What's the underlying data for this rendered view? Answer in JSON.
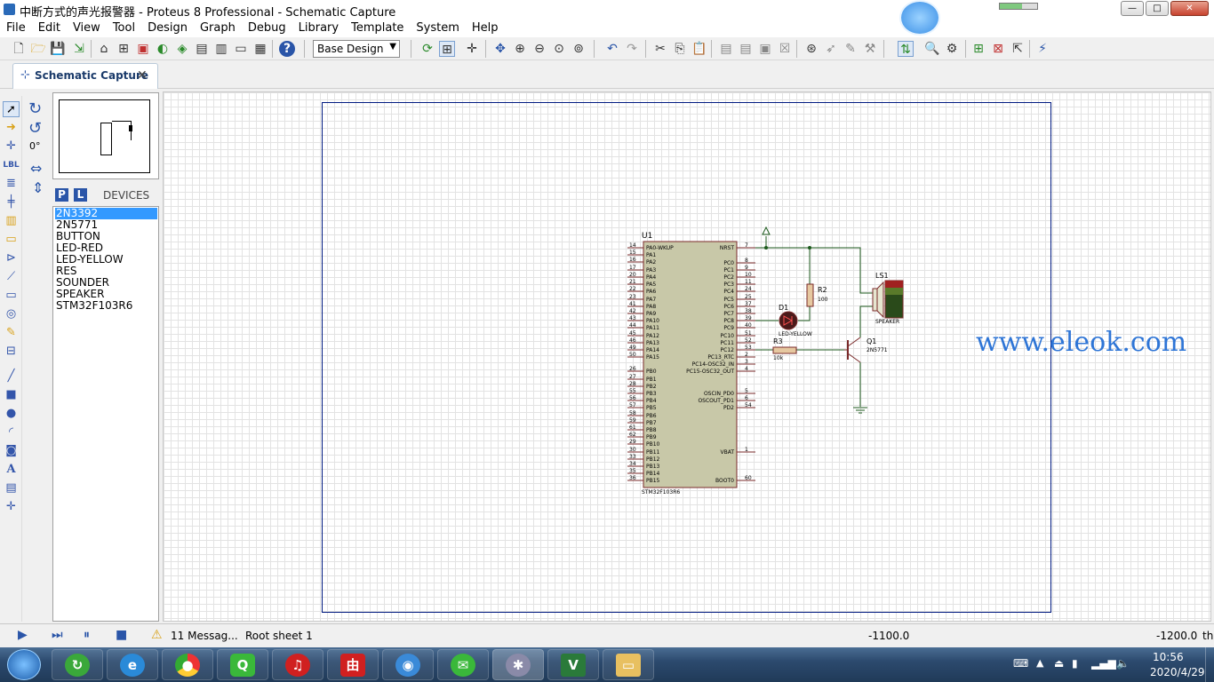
{
  "window": {
    "title": "中断方式的声光报警器 - Proteus 8 Professional - Schematic Capture",
    "controls": {
      "minimize": "—",
      "maximize": "□",
      "close": "✕"
    }
  },
  "menu": [
    "File",
    "Edit",
    "View",
    "Tool",
    "Design",
    "Graph",
    "Debug",
    "Library",
    "Template",
    "System",
    "Help"
  ],
  "toolbar": {
    "design_select": "Base Design",
    "icons": [
      "new",
      "open",
      "save",
      "import",
      "home",
      "schematic",
      "pcb",
      "gerber",
      "3d",
      "bom",
      "notes",
      "help",
      "refresh",
      "grid",
      "origin",
      "pan",
      "zoom-in",
      "zoom-out",
      "zoom-all",
      "zoom-area",
      "undo",
      "redo",
      "cut",
      "copy",
      "paste",
      "block-copy",
      "block-move",
      "block-rotate",
      "block-delete",
      "pick",
      "make-device",
      "packaging",
      "decompose",
      "wire-autoroute",
      "search",
      "property-assign",
      "new-sheet",
      "delete-sheet",
      "exit-to-parent",
      "design-explorer"
    ]
  },
  "tab": {
    "label": "Schematic Capture",
    "close": "✕"
  },
  "left_panel": {
    "rotation": "0°",
    "p_button": "P",
    "l_button": "L",
    "devices_label": "DEVICES",
    "devices": [
      {
        "name": "2N3392",
        "selected": true
      },
      {
        "name": "2N5771",
        "selected": false
      },
      {
        "name": "BUTTON",
        "selected": false
      },
      {
        "name": "LED-RED",
        "selected": false
      },
      {
        "name": "LED-YELLOW",
        "selected": false
      },
      {
        "name": "RES",
        "selected": false
      },
      {
        "name": "SOUNDER",
        "selected": false
      },
      {
        "name": "SPEAKER",
        "selected": false
      },
      {
        "name": "STM32F103R6",
        "selected": false
      }
    ]
  },
  "schematic": {
    "mcu": {
      "ref": "U1",
      "part": "STM32F103R6",
      "left_pins": [
        {
          "num": "14",
          "name": "PA0-WKUP"
        },
        {
          "num": "15",
          "name": "PA1"
        },
        {
          "num": "16",
          "name": "PA2"
        },
        {
          "num": "17",
          "name": "PA3"
        },
        {
          "num": "20",
          "name": "PA4"
        },
        {
          "num": "21",
          "name": "PA5"
        },
        {
          "num": "22",
          "name": "PA6"
        },
        {
          "num": "23",
          "name": "PA7"
        },
        {
          "num": "41",
          "name": "PA8"
        },
        {
          "num": "42",
          "name": "PA9"
        },
        {
          "num": "43",
          "name": "PA10"
        },
        {
          "num": "44",
          "name": "PA11"
        },
        {
          "num": "45",
          "name": "PA12"
        },
        {
          "num": "46",
          "name": "PA13"
        },
        {
          "num": "49",
          "name": "PA14"
        },
        {
          "num": "50",
          "name": "PA15"
        },
        {
          "num": "26",
          "name": "PB0"
        },
        {
          "num": "27",
          "name": "PB1"
        },
        {
          "num": "28",
          "name": "PB2"
        },
        {
          "num": "55",
          "name": "PB3"
        },
        {
          "num": "56",
          "name": "PB4"
        },
        {
          "num": "57",
          "name": "PB5"
        },
        {
          "num": "58",
          "name": "PB6"
        },
        {
          "num": "59",
          "name": "PB7"
        },
        {
          "num": "61",
          "name": "PB8"
        },
        {
          "num": "62",
          "name": "PB9"
        },
        {
          "num": "29",
          "name": "PB10"
        },
        {
          "num": "30",
          "name": "PB11"
        },
        {
          "num": "33",
          "name": "PB12"
        },
        {
          "num": "34",
          "name": "PB13"
        },
        {
          "num": "35",
          "name": "PB14"
        },
        {
          "num": "36",
          "name": "PB15"
        }
      ],
      "right_pins": [
        {
          "num": "7",
          "name": "NRST"
        },
        {
          "num": "8",
          "name": "PC0"
        },
        {
          "num": "9",
          "name": "PC1"
        },
        {
          "num": "10",
          "name": "PC2"
        },
        {
          "num": "11",
          "name": "PC3"
        },
        {
          "num": "24",
          "name": "PC4"
        },
        {
          "num": "25",
          "name": "PC5"
        },
        {
          "num": "37",
          "name": "PC6"
        },
        {
          "num": "38",
          "name": "PC7"
        },
        {
          "num": "39",
          "name": "PC8"
        },
        {
          "num": "40",
          "name": "PC9"
        },
        {
          "num": "51",
          "name": "PC10"
        },
        {
          "num": "52",
          "name": "PC11"
        },
        {
          "num": "53",
          "name": "PC12"
        },
        {
          "num": "2",
          "name": "PC13_RTC"
        },
        {
          "num": "3",
          "name": "PC14-OSC32_IN"
        },
        {
          "num": "4",
          "name": "PC15-OSC32_OUT"
        },
        {
          "num": "5",
          "name": "OSCIN_PD0"
        },
        {
          "num": "6",
          "name": "OSCOUT_PD1"
        },
        {
          "num": "54",
          "name": "PD2"
        },
        {
          "num": "1",
          "name": "VBAT"
        },
        {
          "num": "60",
          "name": "BOOT0"
        }
      ]
    },
    "r2": {
      "ref": "R2",
      "value": "100"
    },
    "r3": {
      "ref": "R3",
      "value": "10k"
    },
    "d1": {
      "ref": "D1",
      "part": "LED-YELLOW"
    },
    "q1": {
      "ref": "Q1",
      "part": "2N5771"
    },
    "ls1": {
      "ref": "LS1",
      "part": "SPEAKER"
    }
  },
  "watermark": "www.eleok.com",
  "status": {
    "messages": "11 Messag...",
    "sheet": "Root sheet 1",
    "x": "-1100.0",
    "y": "-1200.0",
    "unit": "th"
  },
  "taskbar": {
    "apps": [
      "ie-browser",
      "refresh-app",
      "internet-explorer",
      "chrome",
      "iqiyi",
      "netease-music",
      "youdao",
      "qq-browser",
      "wechat",
      "proteus",
      "vsd-app",
      "file-explorer"
    ],
    "time": "10:56",
    "date": "2020/4/29"
  }
}
